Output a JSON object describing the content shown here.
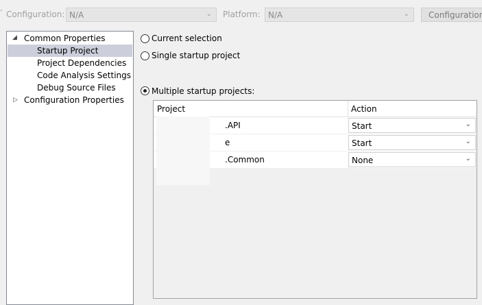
{
  "toolbar": {
    "configuration_label": "Configuration:",
    "configuration_value": "N/A",
    "platform_label": "Platform:",
    "platform_value": "N/A",
    "configuration_manager_button": "Configuration"
  },
  "tree": {
    "root": "Common Properties",
    "children": [
      "Startup Project",
      "Project Dependencies",
      "Code Analysis Settings",
      "Debug Source Files"
    ],
    "second_root": "Configuration Properties",
    "selected": "Startup Project"
  },
  "options": {
    "current_selection": "Current selection",
    "single_startup": "Single startup project",
    "multiple_startup": "Multiple startup projects:",
    "selected_option": "multiple_startup"
  },
  "grid": {
    "headers": {
      "project": "Project",
      "action": "Action"
    },
    "rows": [
      {
        "project": ".API",
        "action": "Start"
      },
      {
        "project": "e",
        "action": "Start"
      },
      {
        "project": ".Common",
        "action": "None"
      }
    ]
  },
  "icons": {
    "dropdown": "chevron-down-icon",
    "tree_expanded": "triangle-down-icon",
    "tree_collapsed": "triangle-right-icon"
  }
}
